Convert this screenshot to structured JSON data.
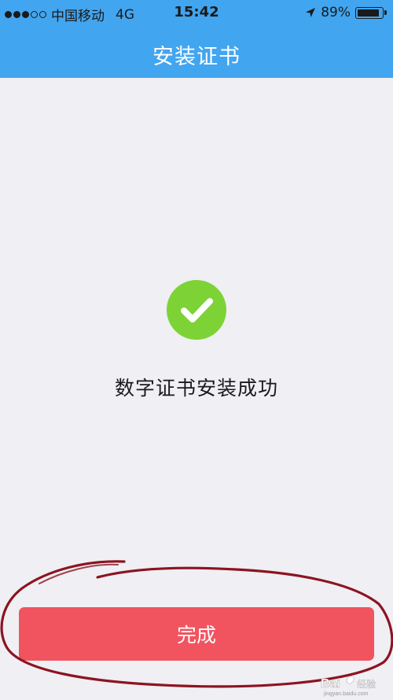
{
  "status_bar": {
    "carrier": "中国移动",
    "network": "4G",
    "time": "15:42",
    "battery_percent": "89%",
    "battery_level": 0.89,
    "signal_strength": 3,
    "signal_max": 5
  },
  "nav": {
    "title": "安装证书"
  },
  "main": {
    "success_icon": "checkmark-circle-icon",
    "message": "数字证书安装成功"
  },
  "footer": {
    "done_label": "完成"
  },
  "watermark": {
    "text": "Bai 经验",
    "subtext": "jingyan.baidu.com"
  },
  "colors": {
    "header_bg": "#42a5f0",
    "page_bg": "#efeff4",
    "success_green": "#7dd335",
    "button_red": "#f1545f",
    "annotation_red": "#8c1420"
  }
}
